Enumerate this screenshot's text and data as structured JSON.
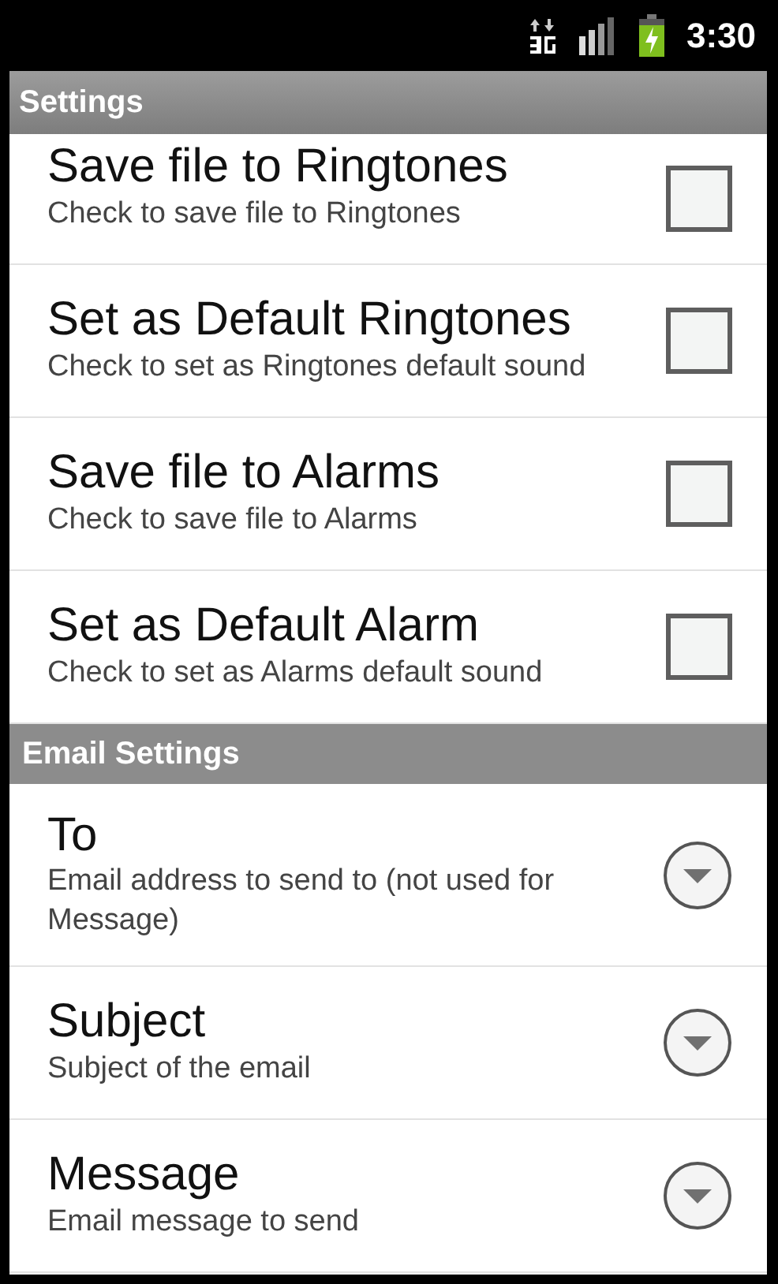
{
  "status_bar": {
    "time": "3:30"
  },
  "title": "Settings",
  "groups": [
    {
      "items": [
        {
          "kind": "checkbox",
          "title": "Save file to Ringtones",
          "summary": "Check to save file to Ringtones",
          "checked": false
        },
        {
          "kind": "checkbox",
          "title": "Set as Default Ringtones",
          "summary": "Check to set as Ringtones default sound",
          "checked": false
        },
        {
          "kind": "checkbox",
          "title": "Save file to Alarms",
          "summary": "Check to save file to Alarms",
          "checked": false
        },
        {
          "kind": "checkbox",
          "title": "Set as Default Alarm",
          "summary": "Check to set as Alarms default sound",
          "checked": false
        }
      ]
    },
    {
      "header": "Email Settings",
      "items": [
        {
          "kind": "dropdown",
          "title": "To",
          "summary": "Email address to send to (not used for Message)"
        },
        {
          "kind": "dropdown",
          "title": "Subject",
          "summary": "Subject of the email"
        },
        {
          "kind": "dropdown",
          "title": "Message",
          "summary": "Email message to send"
        }
      ]
    }
  ]
}
